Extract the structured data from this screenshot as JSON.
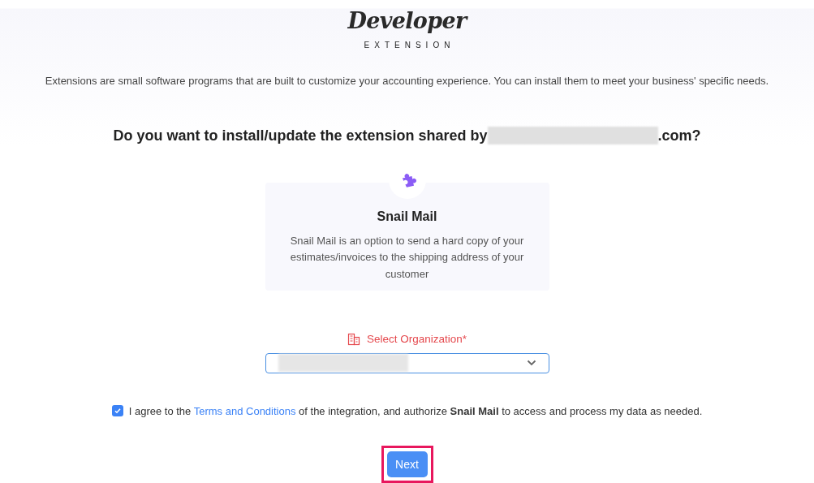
{
  "header": {
    "logo": "Developer",
    "subtitle": "EXTENSION"
  },
  "intro": "Extensions are small software programs that are built to customize your accounting experience. You can install them to meet your business' specific needs.",
  "question": {
    "before": "Do you want to install/update the extension shared by",
    "after": ".com?"
  },
  "extension": {
    "name": "Snail Mail",
    "description": "Snail Mail is an option to send a hard copy of your estimates/invoices to the shipping address of your customer"
  },
  "organization": {
    "label": "Select Organization*"
  },
  "consent": {
    "checked": true,
    "before": "I agree to the",
    "link": "Terms and Conditions",
    "after": "of the integration, and authorize **Snail Mail** to access and process my data as needed."
  },
  "next_button": {
    "label": "Next",
    "highlighted": true
  }
}
